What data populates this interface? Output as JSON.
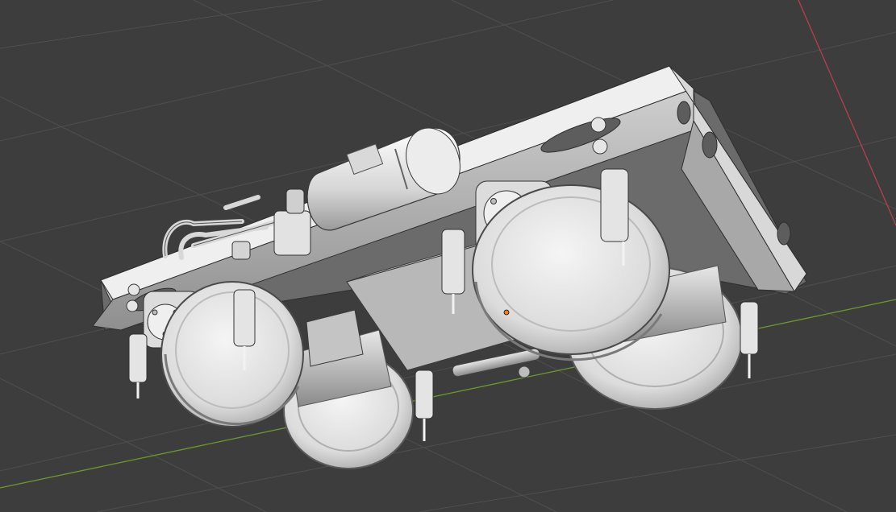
{
  "viewport": {
    "background": "#3d3d3d",
    "grid_color": "#4f4f4f",
    "x_axis_color": "#b5404f",
    "y_axis_color": "#6d9a2a",
    "origin_color": "#f08020"
  },
  "model": {
    "shade_light": "#f2f2f2",
    "shade_mid": "#c9c9c9",
    "shade_dark": "#8c8c8c",
    "shade_deep": "#5a5a5a",
    "outline": "#2e2e2e"
  }
}
